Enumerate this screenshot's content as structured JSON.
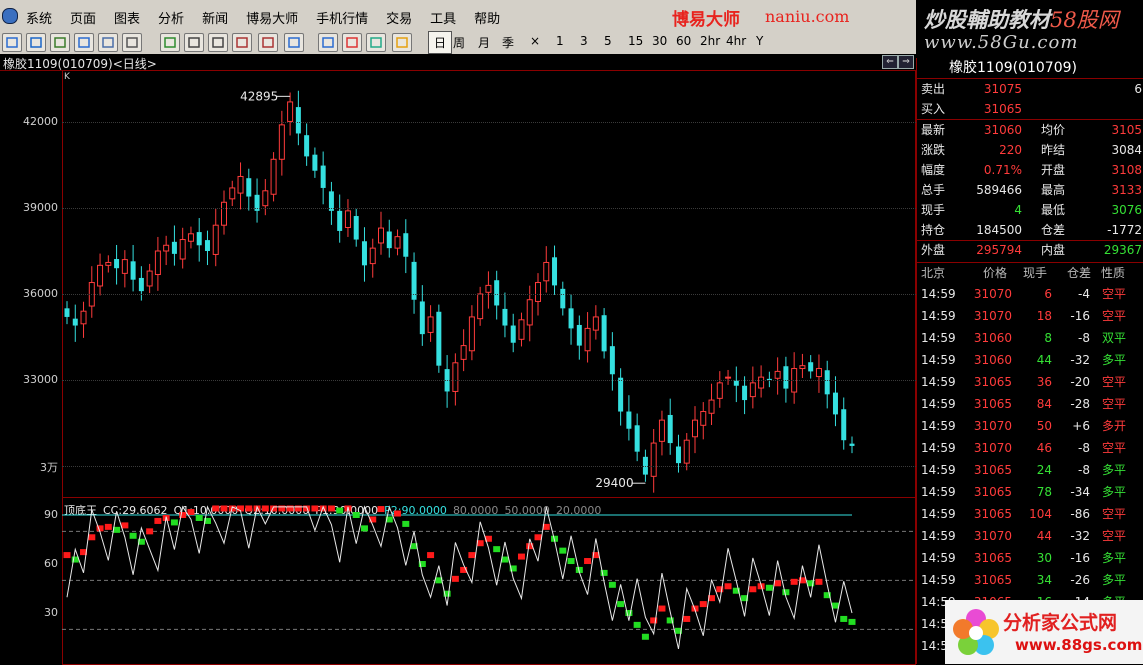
{
  "menu": [
    "系统",
    "页面",
    "图表",
    "分析",
    "新闻",
    "博易大师",
    "手机行情",
    "交易",
    "工具",
    "帮助"
  ],
  "brand": {
    "name": "博易大师",
    "site": "naniu.com"
  },
  "banner": {
    "line1": "炒股輔助教材",
    "line1_accent": "58股网",
    "line2": "www.58Gu.com"
  },
  "toolbar": {
    "periods": [
      "日",
      "周",
      "月",
      "季",
      "×",
      "1",
      "3",
      "5",
      "15",
      "30",
      "60",
      "2hr",
      "4hr",
      "Y"
    ],
    "active_period": "日"
  },
  "chart_header": "橡胶1109(010709)<日线>",
  "kline": {
    "marker_label": "K",
    "high_label": "42895",
    "low_label": "29400",
    "y_ticks": [
      "42000",
      "39000",
      "36000",
      "33000",
      "3万"
    ],
    "closes": [
      35200,
      34900,
      35400,
      36400,
      37000,
      37100,
      36900,
      37200,
      36500,
      36100,
      36800,
      37500,
      37700,
      37400,
      37900,
      38100,
      37700,
      37500,
      38400,
      39200,
      39700,
      40100,
      39400,
      38900,
      39600,
      40700,
      41900,
      42700,
      41600,
      40800,
      40300,
      39700,
      38900,
      38200,
      38900,
      37900,
      37000,
      37600,
      38300,
      37600,
      38000,
      37300,
      35800,
      34600,
      35200,
      33500,
      32600,
      33600,
      34200,
      35200,
      36000,
      36300,
      35600,
      34900,
      34300,
      35100,
      35800,
      36400,
      37100,
      36300,
      35500,
      34800,
      34200,
      34800,
      35200,
      34000,
      33200,
      31900,
      31300,
      30500,
      29700,
      30800,
      31600,
      30800,
      30100,
      30900,
      31600,
      31900,
      32300,
      32900,
      33100,
      32800,
      32300,
      32900,
      33100,
      33000,
      33300,
      32700,
      33400,
      33500,
      33300,
      33400,
      32500,
      31800,
      30900,
      30700
    ]
  },
  "indicator": {
    "name": "顶底王",
    "params": [
      {
        "text": "CC:29.6062",
        "color": "#e8e8e8"
      },
      {
        "text": "Q1:10.0000",
        "color": "#e8e8e8"
      },
      {
        "text": "Q2:10.0000",
        "color": "#e8e8e8"
      },
      {
        "text": "P1:90.0000",
        "color": "#e8e8e8"
      },
      {
        "text": "P2:90.0000",
        "color": "#35e0e0"
      },
      {
        "text": "80.0000",
        "color": "#888888"
      },
      {
        "text": "50.0000",
        "color": "#888888"
      },
      {
        "text": "20.0000",
        "color": "#888888"
      }
    ],
    "y_ticks": [
      "90",
      "60",
      "30"
    ]
  },
  "quote": {
    "title": "橡胶1109(010709)",
    "sell": {
      "label": "卖出",
      "price": "31075",
      "vol": "6"
    },
    "buy": {
      "label": "买入",
      "price": "31065"
    },
    "rows": [
      {
        "l": "最新",
        "v": "31060",
        "vc": "red",
        "l2": "均价",
        "v2": "3105",
        "v2c": "red"
      },
      {
        "l": "涨跌",
        "v": "220",
        "vc": "red",
        "l2": "昨结",
        "v2": "3084",
        "v2c": "white"
      },
      {
        "l": "幅度",
        "v": "0.71%",
        "vc": "red",
        "l2": "开盘",
        "v2": "3108",
        "v2c": "red"
      },
      {
        "l": "总手",
        "v": "589466",
        "vc": "white",
        "l2": "最高",
        "v2": "3133",
        "v2c": "red"
      },
      {
        "l": "现手",
        "v": "4",
        "vc": "green",
        "l2": "最低",
        "v2": "3076",
        "v2c": "green"
      },
      {
        "l": "持仓",
        "v": "184500",
        "vc": "white",
        "l2": "仓差",
        "v2": "-1772",
        "v2c": "white"
      },
      {
        "l": "外盘",
        "v": "295794",
        "vc": "red",
        "l2": "内盘",
        "v2": "29367",
        "v2c": "green"
      }
    ],
    "tick_headers": [
      "北京",
      "价格",
      "现手",
      "仓差",
      "性质"
    ],
    "ticks": [
      {
        "t": "14:59",
        "p": "31070",
        "v": "6",
        "d": "-4",
        "n": "空平",
        "nc": "red"
      },
      {
        "t": "14:59",
        "p": "31070",
        "v": "18",
        "d": "-16",
        "n": "空平",
        "nc": "red"
      },
      {
        "t": "14:59",
        "p": "31060",
        "v": "8",
        "d": "-8",
        "n": "双平",
        "nc": "green"
      },
      {
        "t": "14:59",
        "p": "31060",
        "v": "44",
        "d": "-32",
        "n": "多平",
        "nc": "green"
      },
      {
        "t": "14:59",
        "p": "31065",
        "v": "36",
        "d": "-20",
        "n": "空平",
        "nc": "red"
      },
      {
        "t": "14:59",
        "p": "31065",
        "v": "84",
        "d": "-28",
        "n": "空平",
        "nc": "red"
      },
      {
        "t": "14:59",
        "p": "31070",
        "v": "50",
        "d": "+6",
        "n": "多开",
        "nc": "red"
      },
      {
        "t": "14:59",
        "p": "31070",
        "v": "46",
        "d": "-8",
        "n": "空平",
        "nc": "red"
      },
      {
        "t": "14:59",
        "p": "31065",
        "v": "24",
        "d": "-8",
        "n": "多平",
        "nc": "green"
      },
      {
        "t": "14:59",
        "p": "31065",
        "v": "78",
        "d": "-34",
        "n": "多平",
        "nc": "green"
      },
      {
        "t": "14:59",
        "p": "31065",
        "v": "104",
        "d": "-86",
        "n": "空平",
        "nc": "red"
      },
      {
        "t": "14:59",
        "p": "31070",
        "v": "44",
        "d": "-32",
        "n": "空平",
        "nc": "red"
      },
      {
        "t": "14:59",
        "p": "31065",
        "v": "30",
        "d": "-16",
        "n": "多平",
        "nc": "green"
      },
      {
        "t": "14:59",
        "p": "31065",
        "v": "34",
        "d": "-26",
        "n": "多平",
        "nc": "green"
      },
      {
        "t": "14:59",
        "p": "31065",
        "v": "16",
        "d": "-14",
        "n": "多平",
        "nc": "green"
      },
      {
        "t": "14:5",
        "p": "",
        "v": "",
        "d": "",
        "n": "",
        "nc": "red"
      },
      {
        "t": "14:5",
        "p": "",
        "v": "",
        "d": "",
        "n": "",
        "nc": "red"
      }
    ]
  },
  "logo": {
    "line1": "分析家公式网",
    "line2": "www.88gs.com"
  },
  "colors": {
    "up": "#ff3b3b",
    "down": "#35e0e0",
    "frame": "#8a0000",
    "ind_up": "#ff1a1a",
    "ind_down": "#22dd22"
  }
}
